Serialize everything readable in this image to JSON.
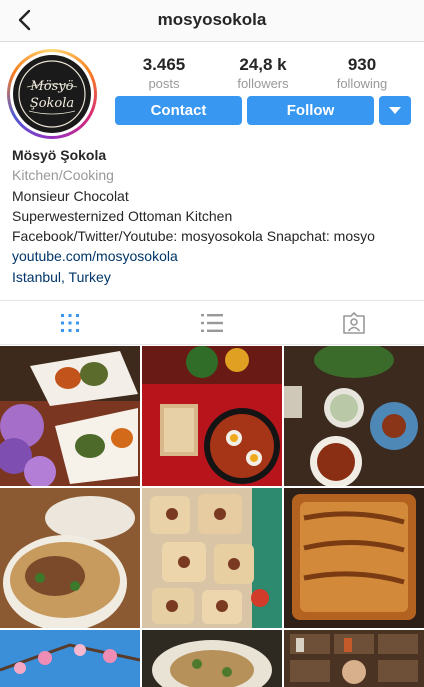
{
  "nav": {
    "title": "mosyosokola",
    "back_icon": "chevron-left-icon"
  },
  "avatar": {
    "logo_text": "Mösyö Şokola"
  },
  "stats": [
    {
      "value": "3.465",
      "label": "posts"
    },
    {
      "value": "24,8 k",
      "label": "followers"
    },
    {
      "value": "930",
      "label": "following"
    }
  ],
  "actions": {
    "contact": "Contact",
    "follow": "Follow",
    "dropdown_icon": "caret-down-icon",
    "accent": "#3897f0"
  },
  "bio": {
    "name": "Mösyö Şokola",
    "category": "Kitchen/Cooking",
    "lines": [
      "Monsieur Chocolat",
      "Superwesternized Ottoman Kitchen",
      "Facebook/Twitter/Youtube: mosyosokola Snapchat: mosyo"
    ],
    "website": "youtube.com/mosyosokola",
    "location": "Istanbul, Turkey"
  },
  "tabs": [
    {
      "icon": "grid-icon",
      "active": true
    },
    {
      "icon": "list-icon",
      "active": false
    },
    {
      "icon": "tagged-person-icon",
      "active": false
    }
  ],
  "posts": [
    {
      "subject": "stuffed vegetables with flowers"
    },
    {
      "subject": "shakshuka with bread"
    },
    {
      "subject": "meze table"
    },
    {
      "subject": "flatbread pide"
    },
    {
      "subject": "filled pastry squares"
    },
    {
      "subject": "baked borek"
    },
    {
      "subject": "blossoms"
    },
    {
      "subject": "plate of food"
    },
    {
      "subject": "kitchen shelves"
    }
  ]
}
